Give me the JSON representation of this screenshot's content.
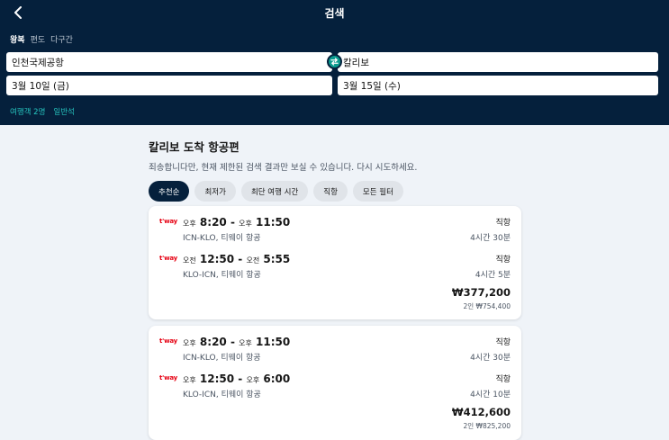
{
  "header": {
    "title": "검색",
    "trip_types": [
      "왕복",
      "편도",
      "다구간"
    ],
    "origin": "인천국제공항",
    "destination": "칼리보",
    "depart_date": "3월 10일 (금)",
    "return_date": "3월 15일 (수)",
    "travelers": "여행객 2명",
    "cabin": "일반석"
  },
  "results": {
    "title": "칼리보 도착 항공편",
    "notice": "죄송합니다만, 현재 제한된 검색 결과만 보실 수 있습니다. 다시 시도하세요.",
    "filters": [
      "추천순",
      "최저가",
      "최단 여행 시간",
      "직항",
      "모든 필터"
    ],
    "cards": [
      {
        "legs": [
          {
            "logo": "t'way",
            "dep_ampm": "오후",
            "dep_time": "8:20",
            "sep": " - ",
            "arr_ampm": "오후",
            "arr_time": "11:50",
            "route": "ICN-KLO, 티웨이 항공",
            "stops": "직항",
            "duration": "4시간 30분"
          },
          {
            "logo": "t'way",
            "dep_ampm": "오전",
            "dep_time": "12:50",
            "sep": " - ",
            "arr_ampm": "오전",
            "arr_time": "5:55",
            "route": "KLO-ICN, 티웨이 항공",
            "stops": "직항",
            "duration": "4시간 5분"
          }
        ],
        "price": "₩377,200",
        "total": "2인 ₩754,400"
      },
      {
        "legs": [
          {
            "logo": "t'way",
            "dep_ampm": "오후",
            "dep_time": "8:20",
            "sep": " - ",
            "arr_ampm": "오후",
            "arr_time": "11:50",
            "route": "ICN-KLO, 티웨이 항공",
            "stops": "직항",
            "duration": "4시간 30분"
          },
          {
            "logo": "t'way",
            "dep_ampm": "오후",
            "dep_time": "12:50",
            "sep": " - ",
            "arr_ampm": "오후",
            "arr_time": "6:00",
            "route": "KLO-ICN, 티웨이 항공",
            "stops": "직항",
            "duration": "4시간 10분"
          }
        ],
        "price": "₩412,600",
        "total": "2인 ₩825,200"
      }
    ]
  },
  "colors": {
    "header_bg": "#05203c",
    "accent": "#0a9b8e",
    "link": "#26c6c0",
    "airline_red": "#e60012"
  }
}
